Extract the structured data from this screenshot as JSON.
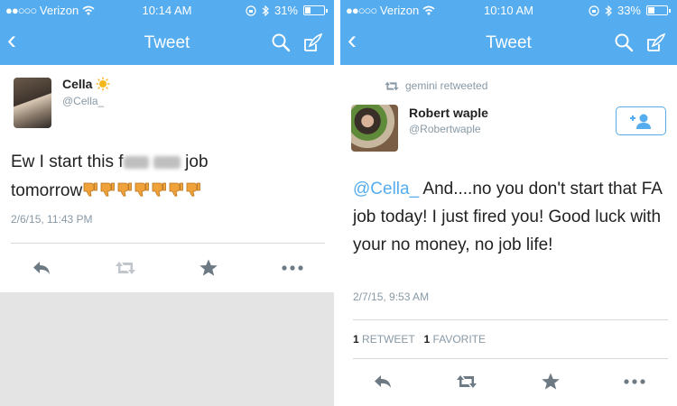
{
  "left": {
    "status": {
      "carrier": "Verizon",
      "time": "10:14 AM",
      "battery": "31%",
      "battery_level": 0.31
    },
    "nav": {
      "title": "Tweet"
    },
    "tweet": {
      "name": "Cella",
      "handle": "@Cella_",
      "text_part1": "Ew I start this f",
      "text_part2": "job",
      "text_part3": "tomorrow",
      "timestamp": "2/6/15, 11:43 PM",
      "emoji_count": 7
    }
  },
  "right": {
    "status": {
      "carrier": "Verizon",
      "time": "10:10 AM",
      "battery": "33%",
      "battery_level": 0.33
    },
    "nav": {
      "title": "Tweet"
    },
    "retweet_note": "gemini retweeted",
    "tweet": {
      "name": "Robert waple",
      "handle": "@Robertwaple",
      "mention": "@Cella_",
      "text": "And....no you don't start that FA job today!  I just fired you! Good luck with your no money, no job life!",
      "timestamp": "2/7/15, 9:53 AM"
    },
    "stats": {
      "retweets": "1",
      "retweets_label": "RETWEET",
      "favorites": "1",
      "favorites_label": "FAVORITE"
    }
  },
  "colors": {
    "twitter_blue": "#55acee",
    "icon_gray": "#8899a6",
    "text": "#222222"
  },
  "icons": [
    "back-icon",
    "search-icon",
    "compose-icon",
    "reply-icon",
    "retweet-icon",
    "favorite-icon",
    "more-icon",
    "follow-icon",
    "wifi-icon",
    "bluetooth-icon",
    "sun-emoji-icon",
    "thumbs-down-emoji-icon"
  ]
}
